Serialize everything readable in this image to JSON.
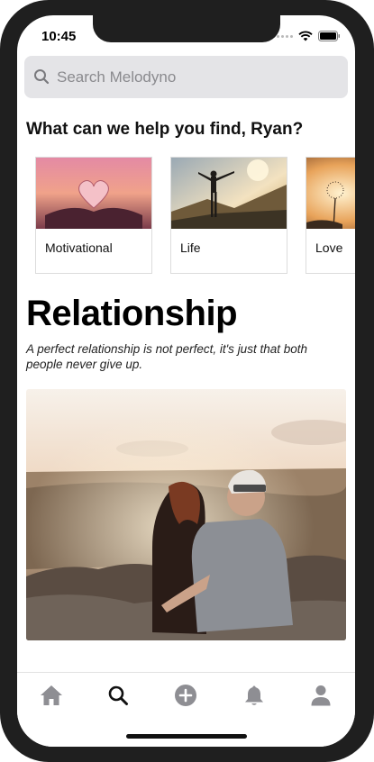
{
  "status_bar": {
    "time": "10:45"
  },
  "search": {
    "placeholder": "Search Melodyno"
  },
  "section": {
    "heading": "What can we help you find, Ryan?"
  },
  "categories": [
    {
      "label": "Motivational",
      "icon": "heart-book-image"
    },
    {
      "label": "Life",
      "icon": "person-mountain-image"
    },
    {
      "label": "Love",
      "icon": "dandelion-image"
    }
  ],
  "feature": {
    "title": "Relationship",
    "quote": "A perfect relationship is not perfect, it's just that both people never give up."
  },
  "tab_bar": {
    "tabs": [
      {
        "name": "home-icon",
        "active": false
      },
      {
        "name": "search-icon",
        "active": true
      },
      {
        "name": "add-icon",
        "active": false
      },
      {
        "name": "bell-icon",
        "active": false
      },
      {
        "name": "profile-icon",
        "active": false
      }
    ]
  },
  "colors": {
    "tab_inactive": "#8e8e93",
    "tab_active": "#111111",
    "search_bg": "#e4e4e7"
  }
}
